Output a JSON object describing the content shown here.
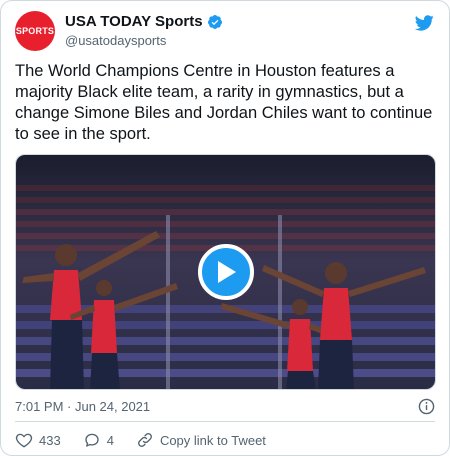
{
  "account": {
    "avatar_text": "SPORTS",
    "display_name": "USA TODAY Sports",
    "handle": "@usatodaysports"
  },
  "tweet": {
    "text": "The World Champions Centre in Houston features a majority Black elite team, a rarity in gymnastics, but a change Simone Biles and Jordan Chiles want to continue to see in the sport.",
    "timestamp": "7:01 PM · Jun 24, 2021"
  },
  "actions": {
    "like_count": "433",
    "reply_count": "4",
    "copy_link_label": "Copy link to Tweet"
  },
  "icons": {
    "verified": "verified-badge-icon",
    "twitter": "twitter-bird-icon",
    "play": "play-icon",
    "info": "info-icon",
    "like": "heart-icon",
    "reply": "reply-bubble-icon",
    "link": "link-icon"
  },
  "colors": {
    "brand_blue": "#1d9bf0",
    "avatar_red": "#e8202e",
    "text_primary": "#0f1419",
    "text_secondary": "#536471",
    "border": "#cfd9de"
  }
}
